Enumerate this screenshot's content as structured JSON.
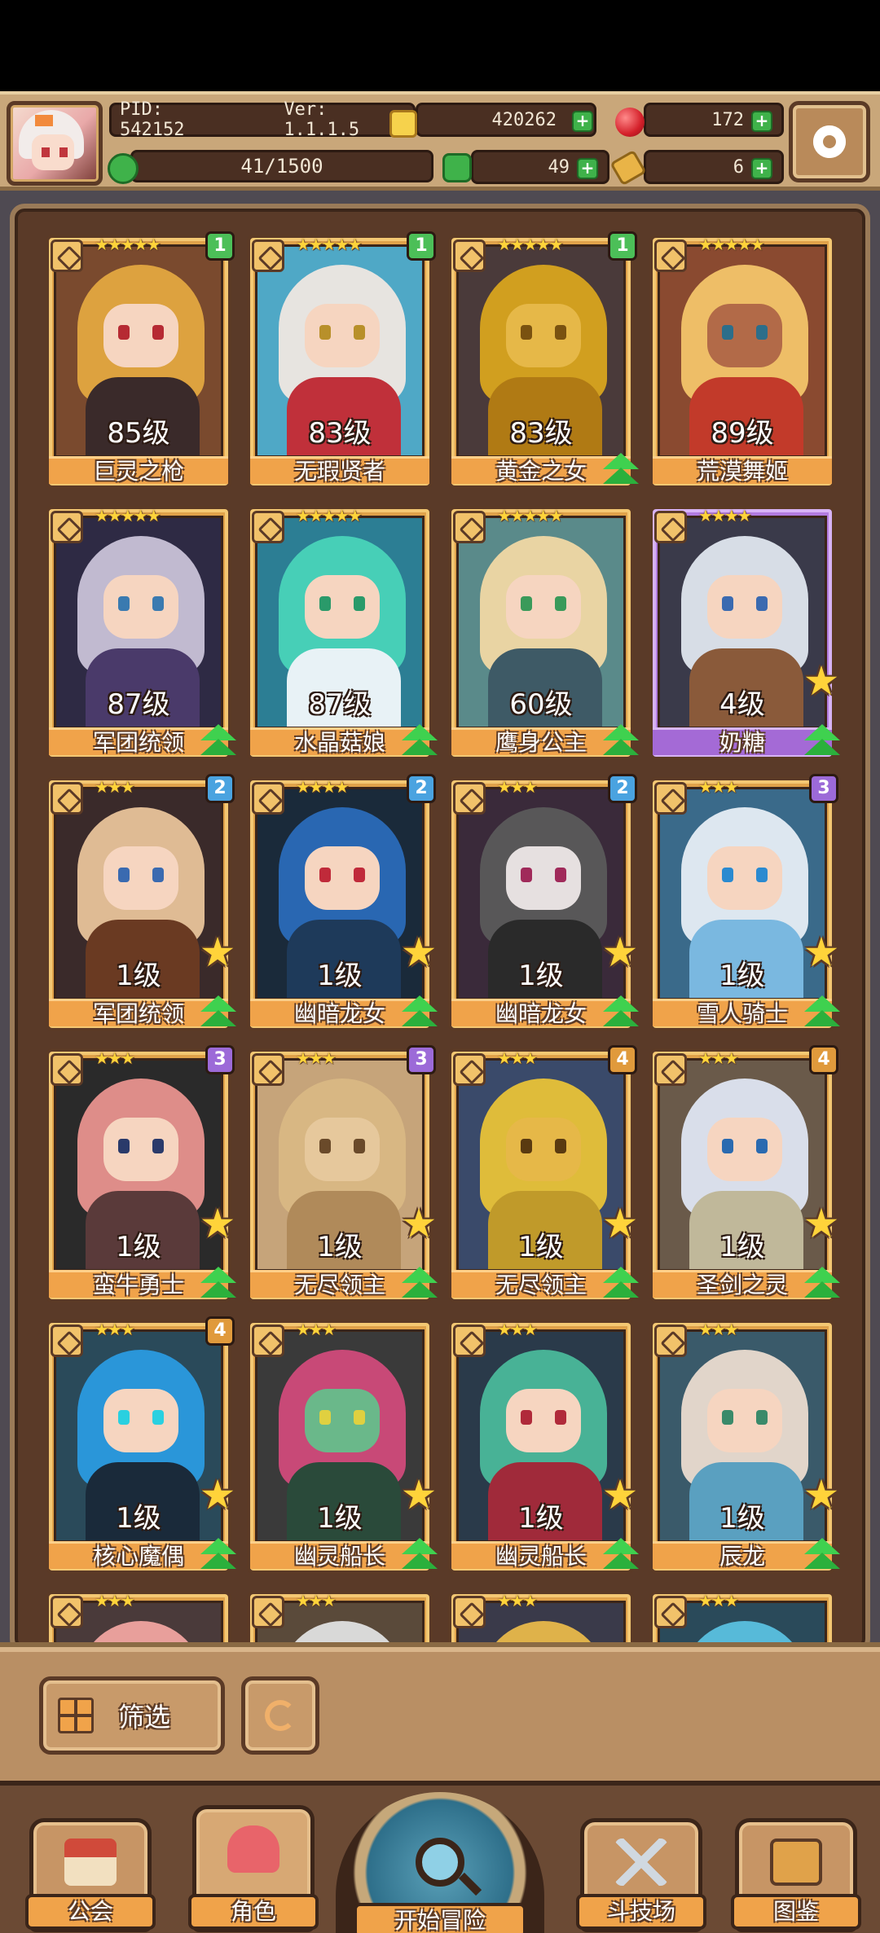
{
  "header": {
    "pid": "PID: 542152",
    "version": "Ver: 1.1.1.5",
    "gold": "420262",
    "gems": "172",
    "stamina": "41/1500",
    "clover": "49",
    "keys": "6"
  },
  "heroes": [
    {
      "name": "巨灵之枪",
      "level": "85级",
      "stars": "★★★★★",
      "tier": "1",
      "frame": "gold",
      "hair": "#e3a640",
      "skin": "#f6d5c0",
      "eye": "#b62a33",
      "body": "#3a2a2a",
      "bg": "#7a4a2e",
      "star_badge": false,
      "upgrade": false
    },
    {
      "name": "无瑕贤者",
      "level": "83级",
      "stars": "★★★★★",
      "tier": "1",
      "frame": "gold",
      "hair": "#efe7e1",
      "skin": "#f6d5c0",
      "eye": "#b8902a",
      "body": "#c0303a",
      "bg": "#4fa8c6",
      "star_badge": false,
      "upgrade": false
    },
    {
      "name": "黄金之女",
      "level": "83级",
      "stars": "★★★★★",
      "tier": "1",
      "frame": "gold",
      "hair": "#d8a41e",
      "skin": "#e6b848",
      "eye": "#7a5210",
      "body": "#b07a14",
      "bg": "#4a3a3a",
      "star_badge": false,
      "upgrade": true
    },
    {
      "name": "荒漠舞姬",
      "level": "89级",
      "stars": "★★★★★",
      "tier": "",
      "frame": "gold",
      "hair": "#f3c46a",
      "skin": "#b26a48",
      "eye": "#2c6e8a",
      "body": "#c23a2a",
      "bg": "#8a4a30",
      "star_badge": false,
      "upgrade": false
    },
    {
      "name": "军团统领",
      "level": "87级",
      "stars": "★★★★★",
      "tier": "",
      "frame": "gold",
      "hair": "#c9c2d8",
      "skin": "#f6d5c0",
      "eye": "#3a7ab0",
      "body": "#4a3a6a",
      "bg": "#2e2a44",
      "star_badge": false,
      "upgrade": true
    },
    {
      "name": "水晶菇娘",
      "level": "87级",
      "stars": "★★★★★",
      "tier": "",
      "frame": "gold",
      "hair": "#49d4b8",
      "skin": "#f6d5c0",
      "eye": "#2a9a6a",
      "body": "#e8f2f6",
      "bg": "#2c7e94",
      "star_badge": false,
      "upgrade": true
    },
    {
      "name": "鹰身公主",
      "level": "60级",
      "stars": "★★★★★",
      "tier": "",
      "frame": "gold",
      "hair": "#f1d8a4",
      "skin": "#f6d5c0",
      "eye": "#3a9a5a",
      "body": "#3e5a66",
      "bg": "#5a8a8a",
      "star_badge": false,
      "upgrade": true
    },
    {
      "name": "奶糖",
      "level": "4级",
      "stars": "★★★★",
      "tier": "",
      "frame": "purple",
      "hair": "#dfe6ee",
      "skin": "#f6d5c0",
      "eye": "#3a6ab0",
      "body": "#8a5a3a",
      "bg": "#3a3a4a",
      "star_badge": true,
      "upgrade": true
    },
    {
      "name": "军团统领",
      "level": "1级",
      "stars": "★★★",
      "tier": "2",
      "frame": "gold",
      "hair": "#e8c39a",
      "skin": "#f6d5c0",
      "eye": "#3a6ab0",
      "body": "#6a3a22",
      "bg": "#3a2a2a",
      "star_badge": true,
      "upgrade": true
    },
    {
      "name": "幽暗龙女",
      "level": "1级",
      "stars": "★★★★",
      "tier": "2",
      "frame": "gold",
      "hair": "#2a6ab8",
      "skin": "#f6d5c0",
      "eye": "#c02a3a",
      "body": "#1e3a5a",
      "bg": "#1a2a3a",
      "star_badge": true,
      "upgrade": true
    },
    {
      "name": "幽暗龙女",
      "level": "1级",
      "stars": "★★★",
      "tier": "2",
      "frame": "gold",
      "hair": "#5a5a5a",
      "skin": "#e6e0e0",
      "eye": "#a02a5a",
      "body": "#2a2a2a",
      "bg": "#3a2a3a",
      "star_badge": true,
      "upgrade": true
    },
    {
      "name": "雪人骑士",
      "level": "1级",
      "stars": "★★★",
      "tier": "3",
      "frame": "gold",
      "hair": "#e6eef6",
      "skin": "#f6d5c0",
      "eye": "#2a8ad0",
      "body": "#7ab8e0",
      "bg": "#3a6a8a",
      "star_badge": true,
      "upgrade": true
    },
    {
      "name": "蛮牛勇士",
      "level": "1级",
      "stars": "★★★",
      "tier": "3",
      "frame": "gold",
      "hair": "#e8928e",
      "skin": "#f6d5c0",
      "eye": "#2a3a6a",
      "body": "#5a3a3a",
      "bg": "#2a2a2a",
      "star_badge": true,
      "upgrade": true
    },
    {
      "name": "无尽领主",
      "level": "1级",
      "stars": "★★★",
      "tier": "3",
      "frame": "gold",
      "hair": "#d9b884",
      "skin": "#e6c89c",
      "eye": "#6a4a2a",
      "body": "#b08a5a",
      "bg": "#c6a47a",
      "star_badge": true,
      "upgrade": true
    },
    {
      "name": "无尽领主",
      "level": "1级",
      "stars": "★★★",
      "tier": "4",
      "frame": "gold",
      "hair": "#e8c238",
      "skin": "#e6b848",
      "eye": "#5a3a10",
      "body": "#c09a2a",
      "bg": "#3a4a6a",
      "star_badge": true,
      "upgrade": true
    },
    {
      "name": "圣剑之灵",
      "level": "1级",
      "stars": "★★★",
      "tier": "4",
      "frame": "gold",
      "hair": "#dfe6f2",
      "skin": "#f6d5c0",
      "eye": "#2a6ab0",
      "body": "#c0b89a",
      "bg": "#6a5a4a",
      "star_badge": true,
      "upgrade": true
    },
    {
      "name": "核心魔偶",
      "level": "1级",
      "stars": "★★★",
      "tier": "4",
      "frame": "gold",
      "hair": "#2a9ae0",
      "skin": "#f6d5c0",
      "eye": "#2ad0e0",
      "body": "#1a2a3a",
      "bg": "#2a4a5a",
      "star_badge": true,
      "upgrade": true
    },
    {
      "name": "幽灵船长",
      "level": "1级",
      "stars": "★★★",
      "tier": "",
      "frame": "gold",
      "hair": "#d04a7a",
      "skin": "#6ab88a",
      "eye": "#e0d040",
      "body": "#2a4a3a",
      "bg": "#3a3a3a",
      "star_badge": true,
      "upgrade": true
    },
    {
      "name": "幽灵船长",
      "level": "1级",
      "stars": "★★★",
      "tier": "",
      "frame": "gold",
      "hair": "#4ab89a",
      "skin": "#f6d5c0",
      "eye": "#b02a3a",
      "body": "#a02a3a",
      "bg": "#2a3a4a",
      "star_badge": true,
      "upgrade": true
    },
    {
      "name": "辰龙",
      "level": "1级",
      "stars": "★★★",
      "tier": "",
      "frame": "gold",
      "hair": "#eadcd0",
      "skin": "#f6d5c0",
      "eye": "#3a8a6a",
      "body": "#5aa0c0",
      "bg": "#3a5a6a",
      "star_badge": true,
      "upgrade": true
    },
    {
      "name": "",
      "level": "",
      "stars": "★★★",
      "tier": "",
      "frame": "gold",
      "hair": "#f0a4a0",
      "skin": "#f6d5c0",
      "eye": "#3a3a3a",
      "body": "#8a5a3a",
      "bg": "#4a3a3a",
      "star_badge": false,
      "upgrade": false
    },
    {
      "name": "",
      "level": "",
      "stars": "★★★",
      "tier": "",
      "frame": "gold",
      "hair": "#e0e0e0",
      "skin": "#f6d5c0",
      "eye": "#3a3a3a",
      "body": "#6a4a3a",
      "bg": "#5a4a3a",
      "star_badge": false,
      "upgrade": false
    },
    {
      "name": "",
      "level": "",
      "stars": "★★★",
      "tier": "",
      "frame": "gold",
      "hair": "#e8b84a",
      "skin": "#f6d5c0",
      "eye": "#3a3a3a",
      "body": "#c0303a",
      "bg": "#3a3a4a",
      "star_badge": false,
      "upgrade": false
    },
    {
      "name": "",
      "level": "",
      "stars": "★★★",
      "tier": "",
      "frame": "gold",
      "hair": "#5ac0e0",
      "skin": "#f6d5c0",
      "eye": "#3a3a3a",
      "body": "#3a6a8a",
      "bg": "#2a4a5a",
      "star_badge": false,
      "upgrade": false
    }
  ],
  "actions": {
    "filter_label": "筛选"
  },
  "nav": {
    "guild": "公会",
    "characters": "角色",
    "adventure": "开始冒险",
    "arena": "斗技场",
    "codex": "图鉴"
  }
}
